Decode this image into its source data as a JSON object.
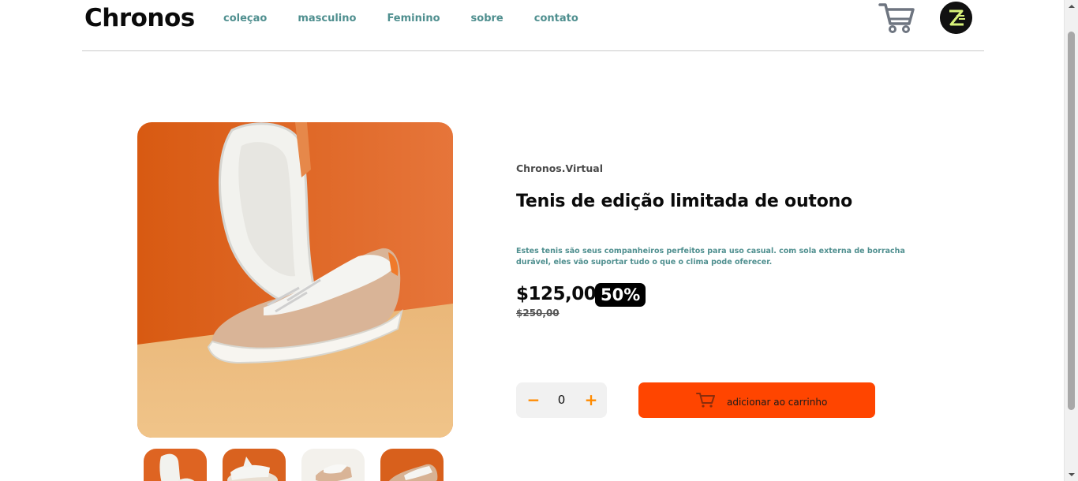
{
  "header": {
    "logo": "Chronos",
    "nav": [
      "coleçao",
      "masculino",
      "Feminino",
      "sobre",
      "contato"
    ]
  },
  "product": {
    "brand": "Chronos.Virtual",
    "title": "Tenis de edição limitada de outono",
    "description": "Estes tenis são seus companheiros perfeitos para uso casual. com sola externa de borracha durável, eles vão suportar tudo o que o clima pode oferecer.",
    "price": "$125,00",
    "discount": "50%",
    "old_price": "$250,00"
  },
  "quantity": {
    "minus": "−",
    "value": "0",
    "plus": "+"
  },
  "add_to_cart": {
    "label": "adicionar ao carrinho"
  },
  "icons": {
    "cart": "shopping-cart-icon",
    "avatar": "avatar"
  },
  "colors": {
    "accent": "#ff4500",
    "nav": "#4f8f8f",
    "stepper": "#ff8a00"
  }
}
